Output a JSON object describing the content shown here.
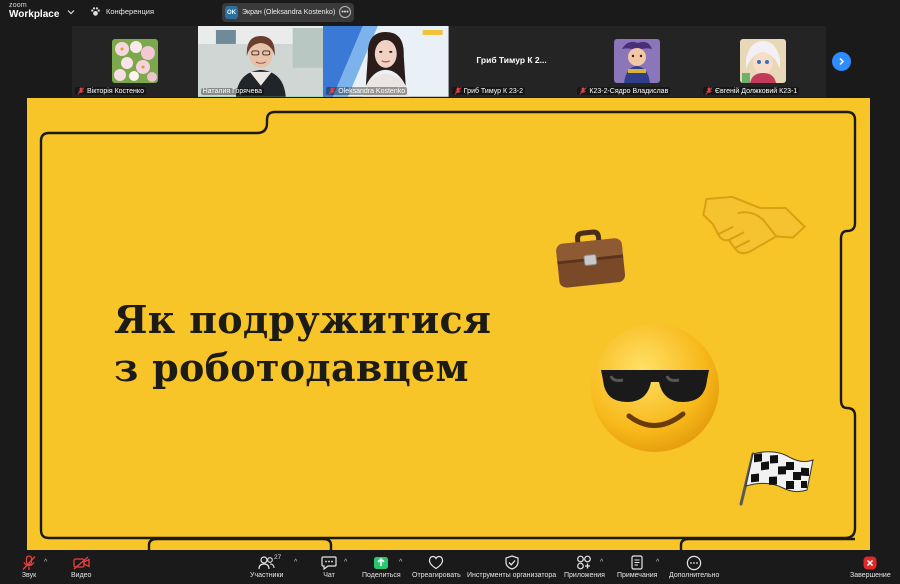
{
  "app": {
    "brand_small": "zoom",
    "brand_large": "Workplace"
  },
  "header": {
    "conference_label": "Конференция",
    "screen_share": {
      "badge": "OK",
      "label": "Экран (Oleksandra Kostenko)"
    }
  },
  "gallery": {
    "tiles": [
      {
        "name": "Вікторія Костенко",
        "muted": true,
        "kind": "avatar-flowers"
      },
      {
        "name": "Наталия Горячева",
        "muted": false,
        "kind": "video-woman-glasses",
        "active": true
      },
      {
        "name": "Oleksandra Kostenko",
        "muted": true,
        "kind": "video-woman-dark-hair"
      },
      {
        "name": "Гриб Тимур К 23-2",
        "muted": true,
        "kind": "name-only",
        "center_text": "Гриб Тимур К 2..."
      },
      {
        "name": "К23-2-Сядро Владислав",
        "muted": true,
        "kind": "avatar-anime"
      },
      {
        "name": "Євгеній Должковий К23-1",
        "muted": true,
        "kind": "avatar-anime2"
      }
    ]
  },
  "slide": {
    "title_line1": "Як подружитися",
    "title_line2": "з роботодавцем"
  },
  "toolbar": {
    "audio": "Звук",
    "video": "Видео",
    "participants": "Участники",
    "participants_count": "27",
    "chat": "Чат",
    "share": "Поделиться",
    "react": "Отреагировать",
    "host_tools": "Инструменты организатора",
    "apps": "Приложения",
    "notes": "Примечания",
    "more": "Дополнительно",
    "end": "Завершение"
  },
  "colors": {
    "slide_bg": "#f7c527",
    "active_outline": "#2ecc71",
    "accent_blue": "#2d8cff",
    "end_red": "#e02828"
  }
}
